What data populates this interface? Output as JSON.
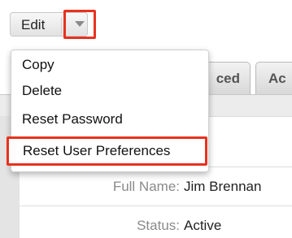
{
  "toolbar": {
    "edit_label": "Edit",
    "highlight_color": "#e8321e"
  },
  "tabs": [
    {
      "label": "ced"
    },
    {
      "label": "Ac"
    }
  ],
  "detail": {
    "full_name": {
      "label": "Full Name:",
      "value": "Jim Brennan"
    },
    "status": {
      "label": "Status:",
      "value": "Active"
    }
  },
  "menu": {
    "items": [
      {
        "label": "Copy"
      },
      {
        "label": "Delete"
      },
      {
        "label": "Reset Password"
      },
      {
        "label": "Reset User Preferences"
      }
    ]
  }
}
